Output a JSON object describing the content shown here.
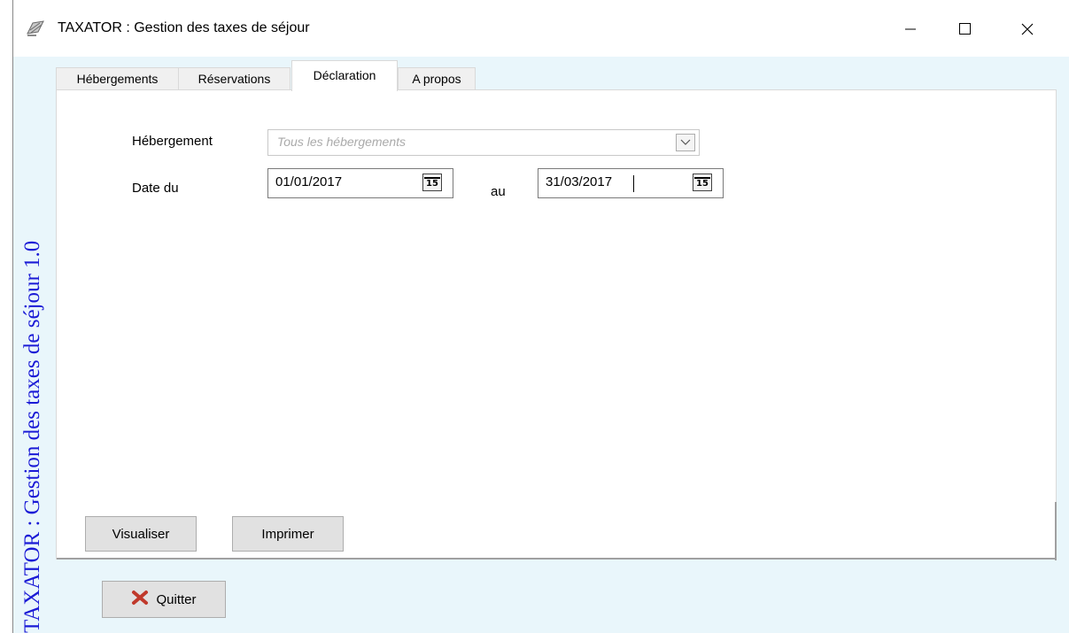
{
  "window": {
    "title": "TAXATOR : Gestion des taxes de séjour",
    "controls": {
      "minimize": "minimize",
      "maximize": "maximize",
      "close": "close"
    }
  },
  "banner": {
    "text": "TAXATOR : Gestion des taxes de séjour    1.0"
  },
  "tabs": [
    {
      "label": "Hébergements",
      "active": false
    },
    {
      "label": "Réservations",
      "active": false
    },
    {
      "label": "Déclaration",
      "active": true
    },
    {
      "label": "A propos",
      "active": false
    }
  ],
  "form": {
    "hebergement_label": "Hébergement",
    "hebergement_value": "Tous les hébergements",
    "date_label": "Date du",
    "date_from": "01/01/2017",
    "to_label": "au",
    "date_to": "31/03/2017",
    "calendar_icon_text": "15"
  },
  "actions": {
    "visualiser": "Visualiser",
    "imprimer": "Imprimer"
  },
  "footer": {
    "quit": "Quitter",
    "quit_icon_color": "#c0392b"
  },
  "colors": {
    "banner_bg": "#e9f6fb",
    "banner_text": "#1a1ad6"
  }
}
